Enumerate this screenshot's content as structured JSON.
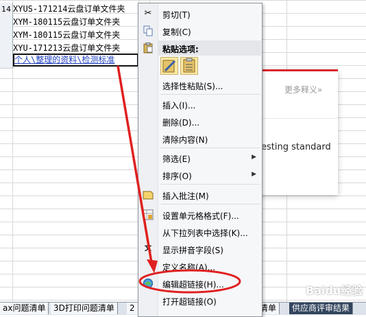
{
  "rows": [
    {
      "num": "14",
      "text": "XYUS-171214云盘订单文件夹"
    },
    {
      "num": "",
      "text": "XYM-180115云盘订单文件夹"
    },
    {
      "num": "",
      "text": "XYM-180115云盘订单文件夹"
    },
    {
      "num": "",
      "text": "XYU-171213云盘订单文件夹"
    },
    {
      "num": "",
      "text": "个人\\整理的资料\\检测标准"
    }
  ],
  "menu": {
    "cut": "剪切(T)",
    "copy": "复制(C)",
    "paste_header": "粘贴选项:",
    "paste_special": "选择性粘贴(S)...",
    "insert": "插入(I)...",
    "delete": "删除(D)...",
    "clear": "清除内容(N)",
    "filter": "筛选(E)",
    "sort": "排序(O)",
    "insert_comment": "插入批注(M)",
    "format_cells": "设置单元格格式(F)...",
    "pick_list": "从下拉列表中选择(K)...",
    "phonetic": "显示拼音字段(S)",
    "define_name": "定义名称(A)...",
    "edit_hyperlink": "编辑超链接(H)...",
    "open_hyperlink": "打开超链接(O)"
  },
  "popup": {
    "more": "更多释义»",
    "meaning": "esting standard"
  },
  "tabs": [
    "ax问题清单",
    "3D打印问题清单",
    "2",
    "清单",
    "供应商评审结果"
  ],
  "watermark": "Baidu经验",
  "colors": {
    "accent_red": "#d9252b",
    "link_blue": "#1f3fbf",
    "tab_dark": "#33455e"
  }
}
